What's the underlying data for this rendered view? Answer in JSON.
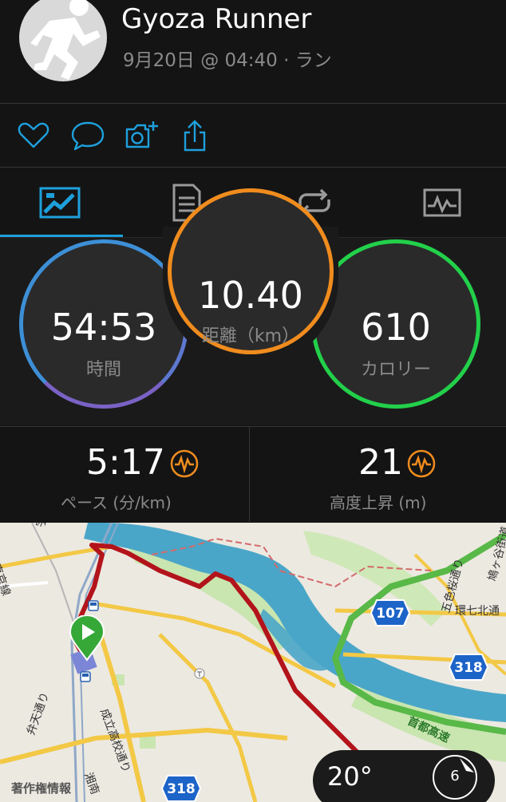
{
  "header": {
    "athlete_name": "Gyoza Runner",
    "activity_meta": "9月20日 @ 04:40 · ラン"
  },
  "actions": {
    "like_icon": "heart-icon",
    "comment_icon": "comment-icon",
    "photo_icon": "camera-add-icon",
    "share_icon": "share-icon"
  },
  "tabs": [
    {
      "icon": "overview-icon",
      "selected": true
    },
    {
      "icon": "details-icon",
      "selected": false
    },
    {
      "icon": "laps-icon",
      "selected": false
    },
    {
      "icon": "charts-icon",
      "selected": false
    }
  ],
  "summary": {
    "time": {
      "value": "54:53",
      "label": "時間"
    },
    "distance": {
      "value": "10.40",
      "label": "距離（km）"
    },
    "calories": {
      "value": "610",
      "label": "カロリー"
    }
  },
  "stats": {
    "pace": {
      "value": "5:17",
      "label": "ペース (分/km)"
    },
    "elevation": {
      "value": "21",
      "label": "高度上昇 (m)"
    }
  },
  "map": {
    "labels": {
      "utsunomiya_line": "宇都宮線",
      "keihin_line": "東京線",
      "benten": "弁天通り",
      "seiritsu": "成立高校通り",
      "shonan": "湘南",
      "goshiki": "五色桜通り",
      "hatogaya": "鳩ヶ谷街道",
      "kanshichi": "環七北通",
      "shutoko": "首都高速",
      "copyright": "著作権情報"
    },
    "route_shields": {
      "r107": "107",
      "r318a": "318",
      "r318b": "318"
    },
    "weather": {
      "temperature": "20°",
      "wind": "6"
    }
  },
  "colors": {
    "accent": "#1ea0dc",
    "time_ring": "#3d8fd6",
    "distance_ring": "#f08c1e",
    "calories_ring": "#22d04a",
    "route": "#b3141b",
    "river": "#4aa6c8"
  }
}
